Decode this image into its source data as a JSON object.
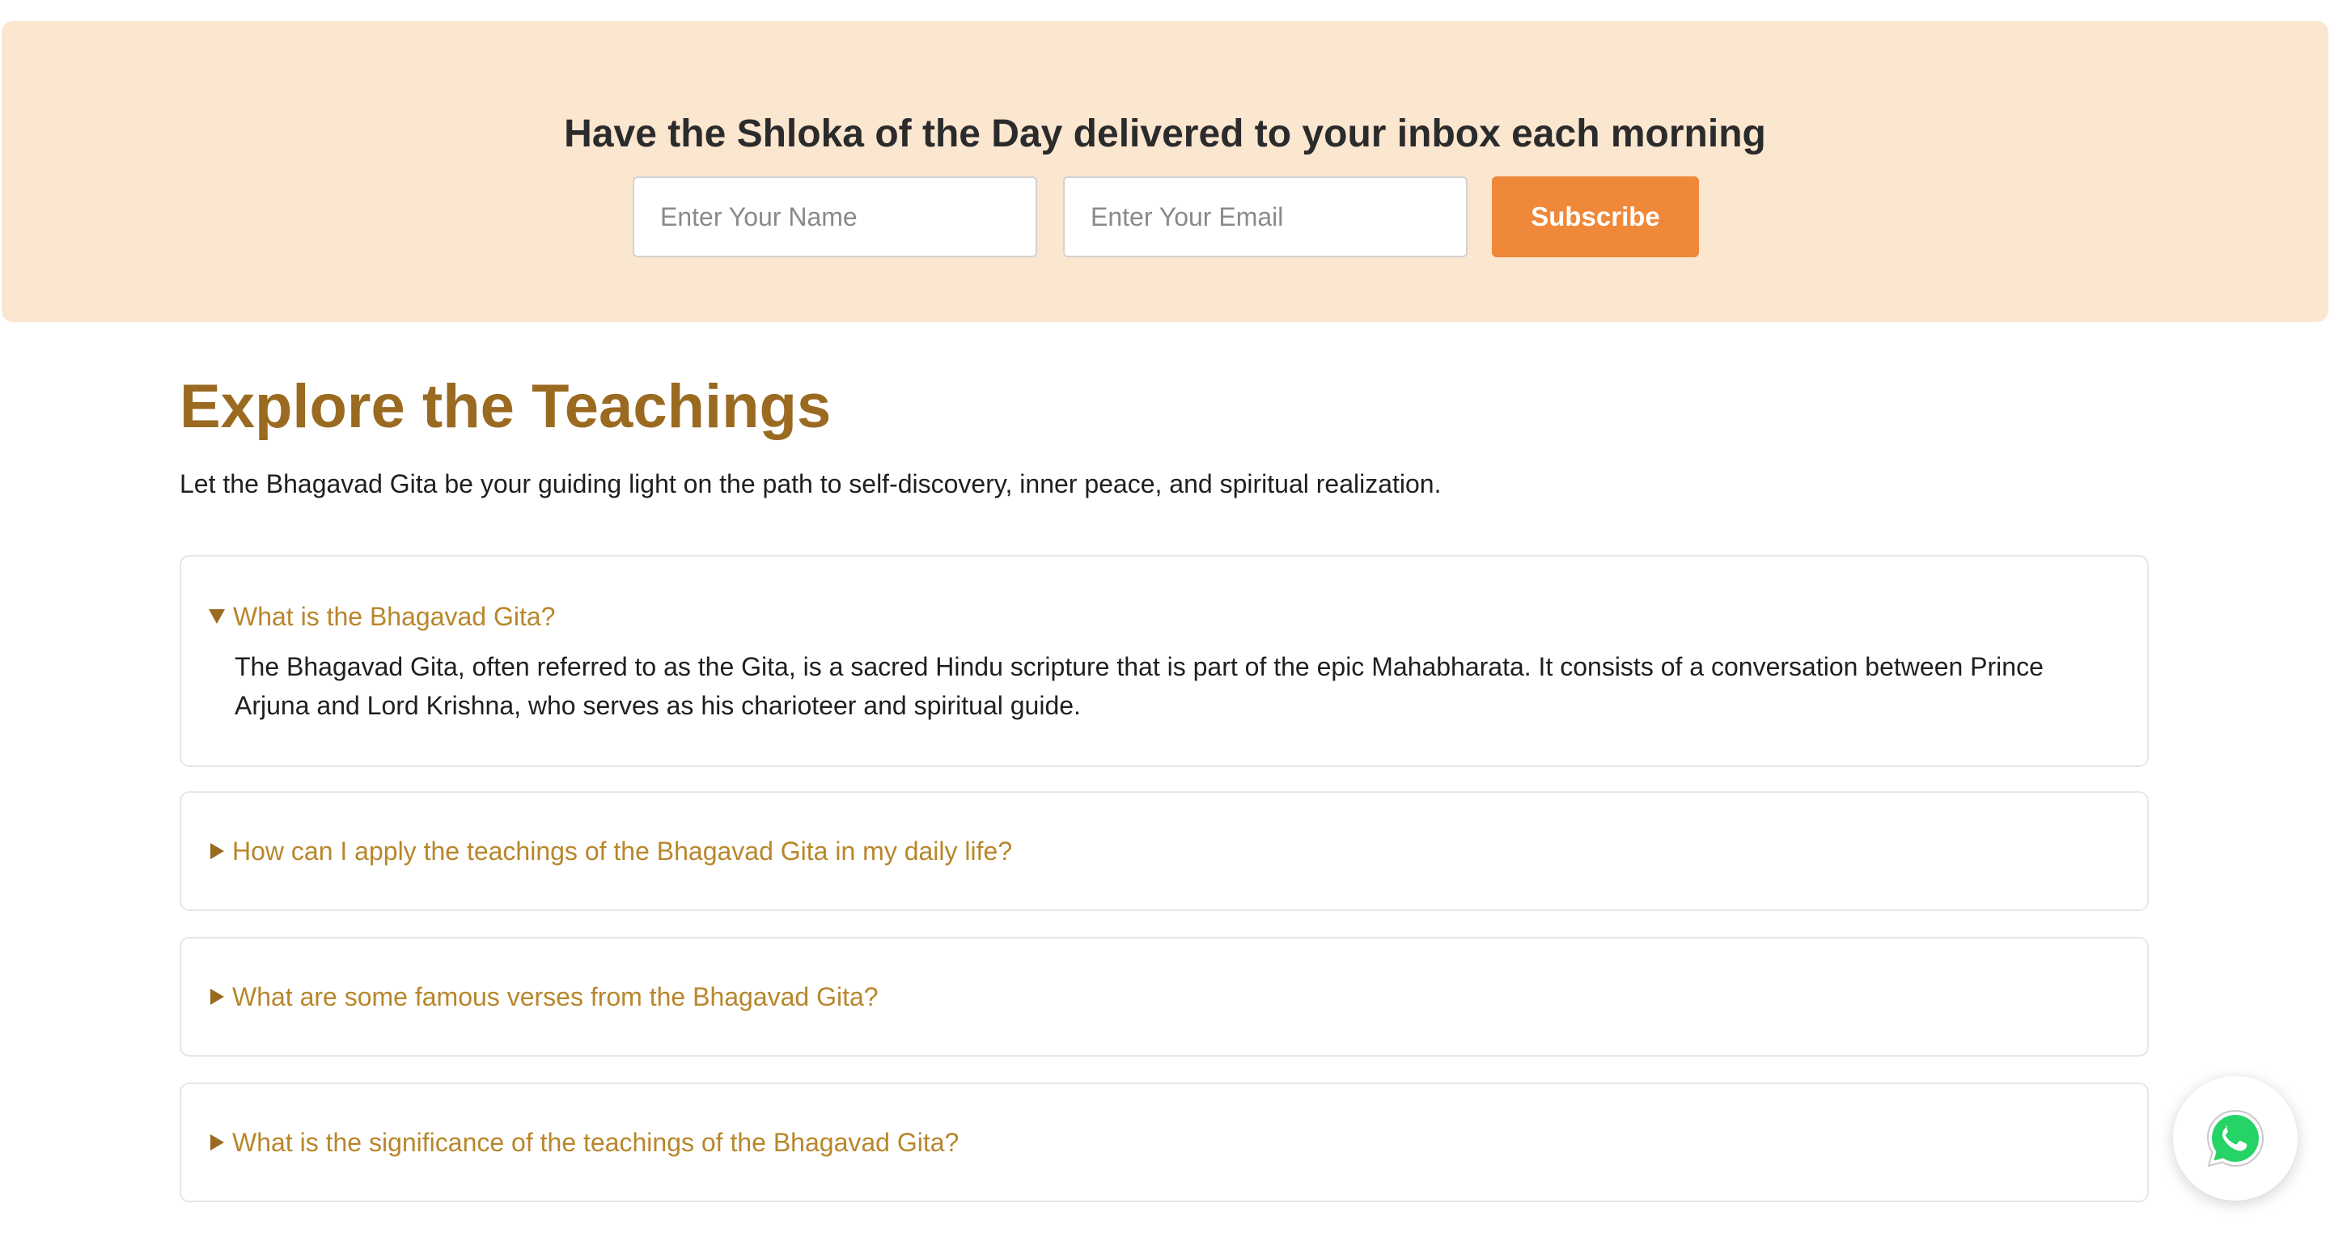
{
  "newsletter": {
    "title": "Have the Shloka of the Day delivered to your inbox each morning",
    "name_placeholder": "Enter Your Name",
    "email_placeholder": "Enter Your Email",
    "subscribe_label": "Subscribe"
  },
  "teachings": {
    "title": "Explore the Teachings",
    "intro": "Let the Bhagavad Gita be your guiding light on the path to self-discovery, inner peace, and spiritual realization."
  },
  "faq": [
    {
      "question": "What is the Bhagavad Gita?",
      "expanded": true,
      "answer": "The Bhagavad Gita, often referred to as the Gita, is a sacred Hindu scripture that is part of the epic Mahabharata. It consists of a conversation between Prince Arjuna and Lord Krishna, who serves as his charioteer and spiritual guide."
    },
    {
      "question": "How can I apply the teachings of the Bhagavad Gita in my daily life?",
      "expanded": false
    },
    {
      "question": "What are some famous verses from the Bhagavad Gita?",
      "expanded": false
    },
    {
      "question": "What is the significance of the teachings of the Bhagavad Gita?",
      "expanded": false
    }
  ],
  "icons": {
    "expanded_toggle": "caret-down-icon",
    "collapsed_toggle": "caret-right-icon",
    "chat": "whatsapp-icon"
  },
  "colors": {
    "banner_bg": "#fbe6d0",
    "accent": "#f0883a",
    "heading": "#9a6a21",
    "question": "#b8862b",
    "whatsapp": "#25d366"
  }
}
